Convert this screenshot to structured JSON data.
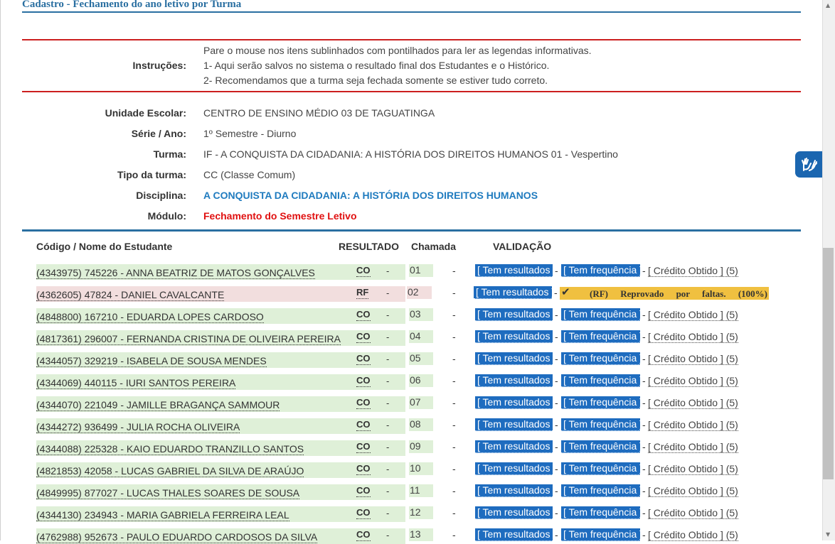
{
  "page": {
    "title": "Cadastro - Fechamento do ano letivo por Turma"
  },
  "instructions": {
    "label": "Instruções:",
    "lines": [
      "Pare o mouse nos itens sublinhados com pontilhados para ler as legendas informativas.",
      "1- Aqui serão salvos no sistema o resultado final dos Estudantes e o Histórico.",
      "2- Recomendamos que a turma seja fechada somente se estiver tudo correto."
    ]
  },
  "info": {
    "unidade": {
      "label": "Unidade Escolar:",
      "value": "CENTRO DE ENSINO MÉDIO 03 DE TAGUATINGA"
    },
    "serie": {
      "label": "Série / Ano:",
      "value": "1º Semestre - Diurno"
    },
    "turma": {
      "label": "Turma:",
      "value": "IF - A CONQUISTA DA CIDADANIA: A HISTÓRIA DOS DIREITOS HUMANOS 01 - Vespertino"
    },
    "tipo": {
      "label": "Tipo da turma:",
      "value": "CC (Classe Comum)"
    },
    "disciplina": {
      "label": "Disciplina:",
      "value": "A CONQUISTA DA CIDADANIA: A HISTÓRIA DOS DIREITOS HUMANOS"
    },
    "modulo": {
      "label": "Módulo:",
      "value": "Fechamento do Semestre Letivo"
    }
  },
  "table": {
    "headers": {
      "name": "Código / Nome do Estudante",
      "result": "RESULTADO",
      "chamada": "Chamada",
      "validacao": "VALIDAÇÃO"
    },
    "dash": "-",
    "btn_resultados": "[ Tem resultados ]",
    "btn_frequencia": "[ Tem frequência ]",
    "credit": "[ Crédito Obtido ] (5)",
    "warning": "(RF) Reprovado por faltas. (100%)",
    "rows": [
      {
        "name": "(4343975) 745226 - ANNA BEATRIZ DE MATOS GONÇALVES",
        "result": "CO",
        "chamada": "01"
      },
      {
        "name": "(4362605) 47824 - DANIEL CAVALCANTE",
        "result": "RF",
        "chamada": "02"
      },
      {
        "name": "(4848800) 167210 - EDUARDA LOPES CARDOSO",
        "result": "CO",
        "chamada": "03"
      },
      {
        "name": "(4817361) 296007 - FERNANDA CRISTINA DE OLIVEIRA PEREIRA",
        "result": "CO",
        "chamada": "04"
      },
      {
        "name": "(4344057) 329219 - ISABELA DE SOUSA MENDES",
        "result": "CO",
        "chamada": "05"
      },
      {
        "name": "(4344069) 440115 - IURI SANTOS PEREIRA",
        "result": "CO",
        "chamada": "06"
      },
      {
        "name": "(4344070) 221049 - JAMILLE BRAGANÇA SAMMOUR",
        "result": "CO",
        "chamada": "07"
      },
      {
        "name": "(4344272) 936499 - JULIA ROCHA OLIVEIRA",
        "result": "CO",
        "chamada": "08"
      },
      {
        "name": "(4344088) 225328 - KAIO EDUARDO TRANZILLO SANTOS",
        "result": "CO",
        "chamada": "09"
      },
      {
        "name": "(4821853) 42058 - LUCAS GABRIEL DA SILVA DE ARAÚJO",
        "result": "CO",
        "chamada": "10"
      },
      {
        "name": "(4849995) 877027 - LUCAS THALES SOARES DE SOUSA",
        "result": "CO",
        "chamada": "11"
      },
      {
        "name": "(4344130) 234943 - MARIA GABRIELA FERREIRA LEAL",
        "result": "CO",
        "chamada": "12"
      },
      {
        "name": "(4762988) 952673 - PAULO EDUARDO CARDOSOS DA SILVA",
        "result": "CO",
        "chamada": "13"
      }
    ]
  },
  "icons": {
    "vlibras": "sign-language-hands-icon",
    "check": "checkmark-icon"
  }
}
